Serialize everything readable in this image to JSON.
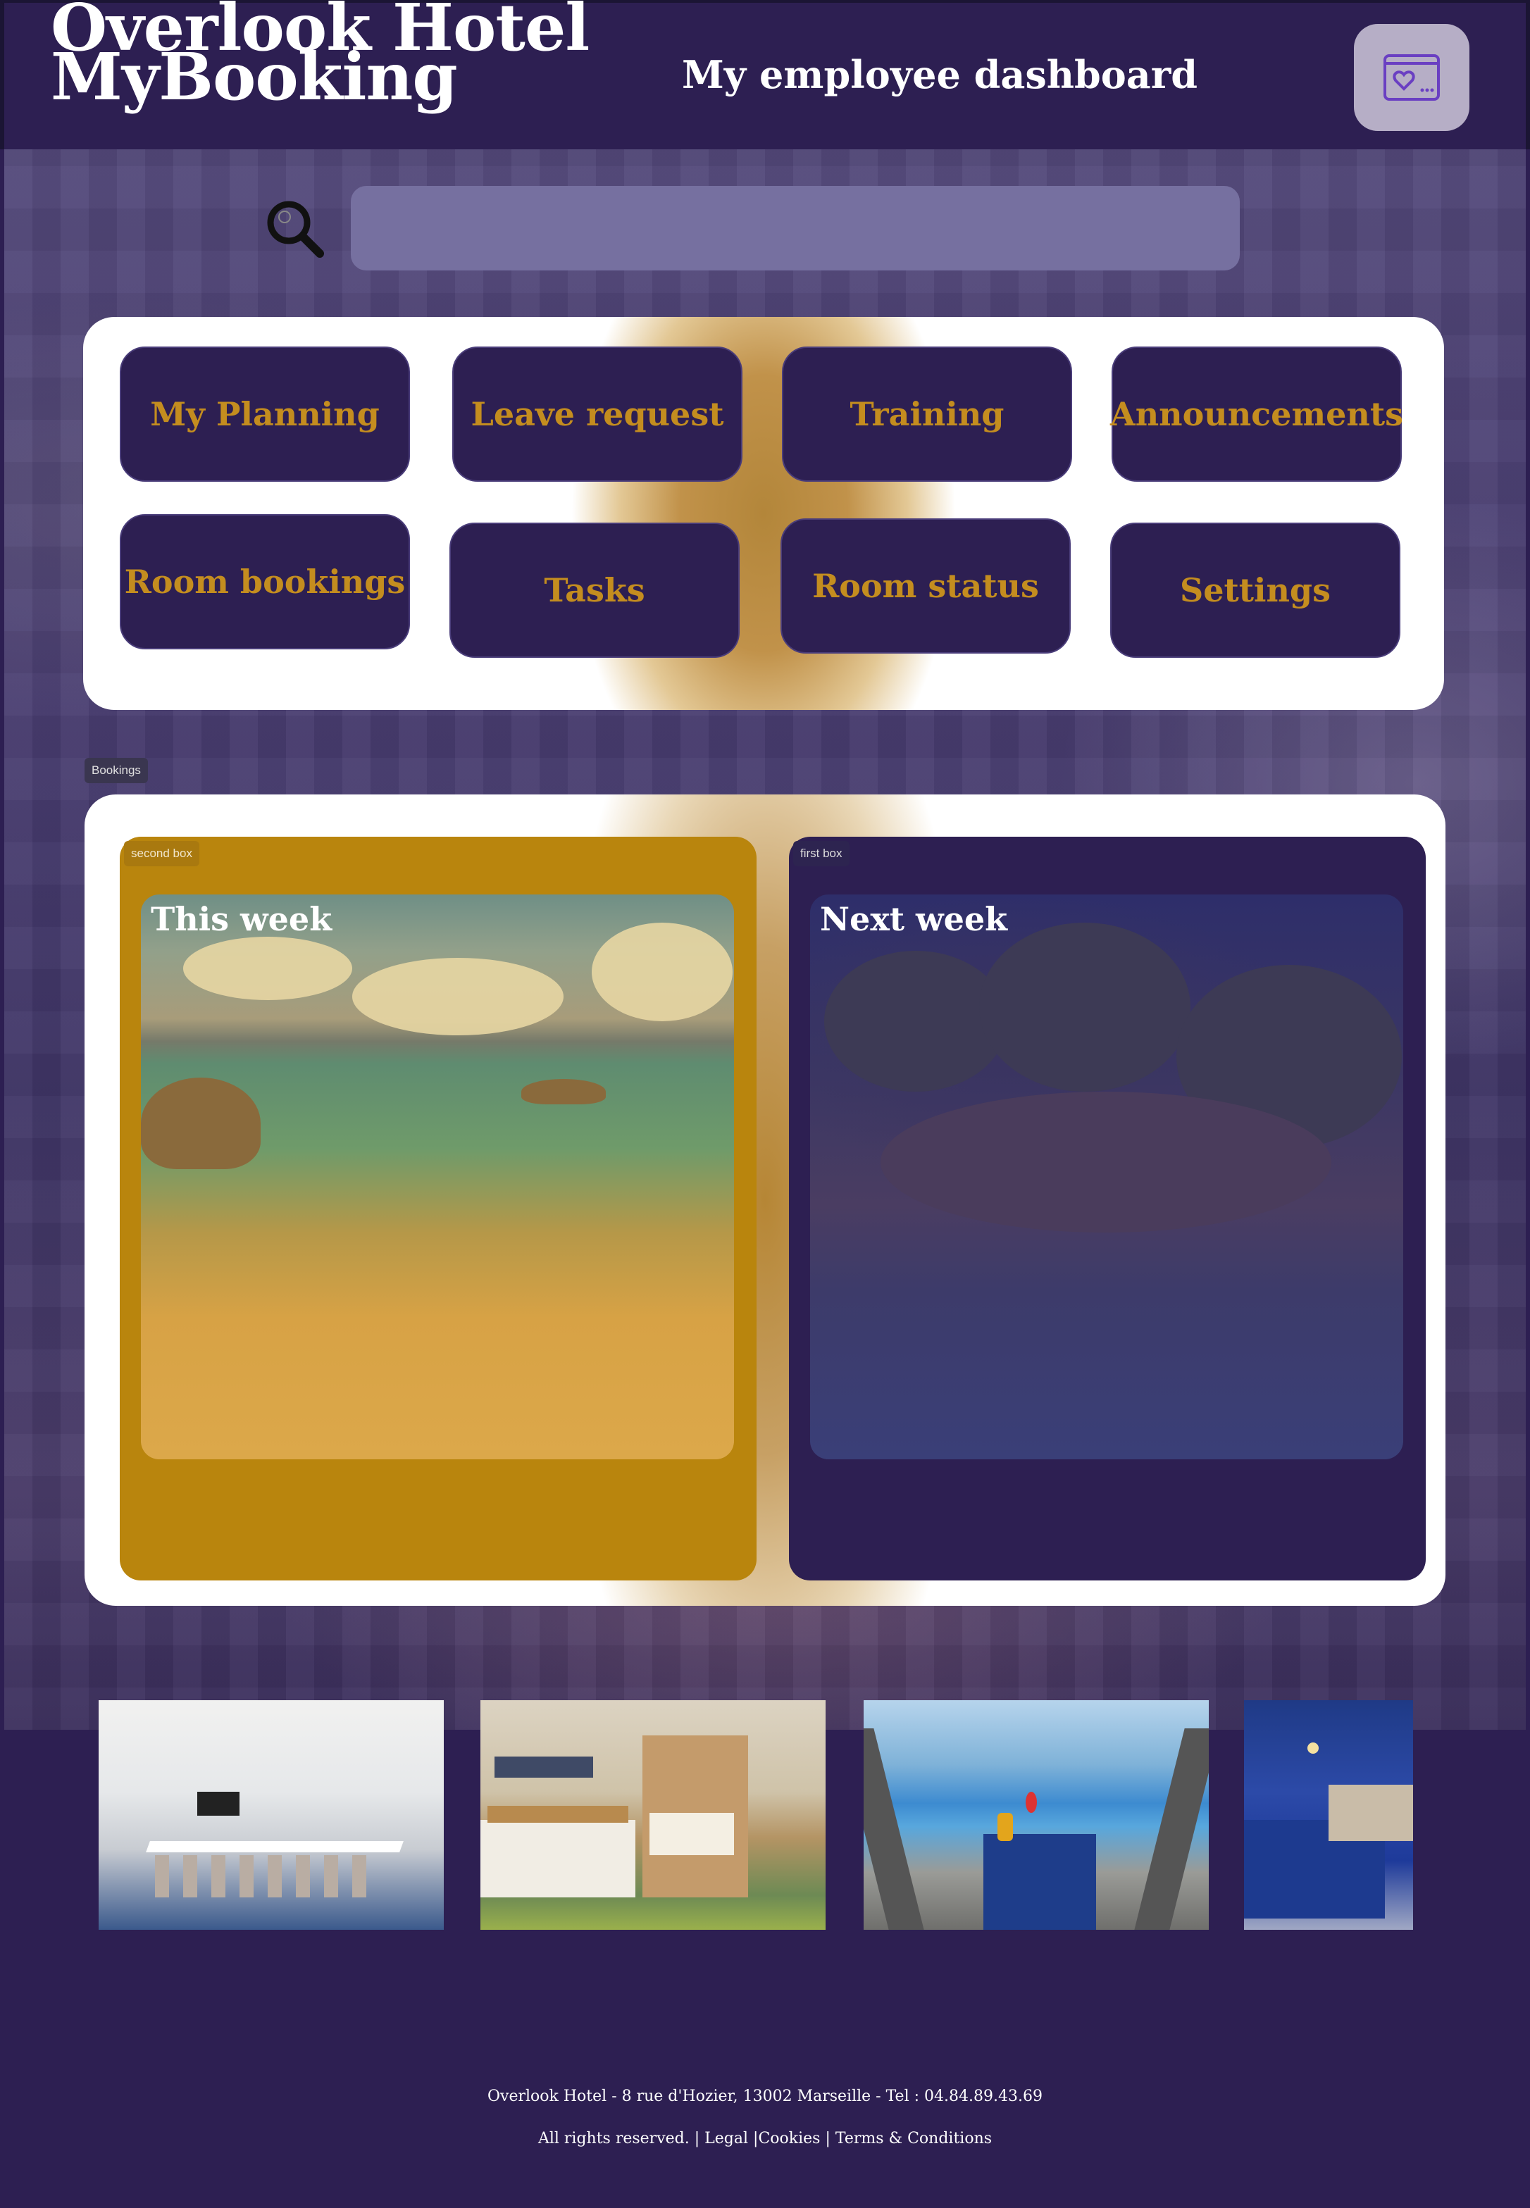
{
  "header": {
    "brand_line1": "Overlook Hotel",
    "brand_line2": "MyBooking",
    "dashboard_title": "My employee dashboard",
    "account_icon": "profile-heart-icon"
  },
  "search": {
    "icon": "search-icon",
    "placeholder": ""
  },
  "menu": {
    "items": [
      {
        "label": "My Planning"
      },
      {
        "label": "Leave request"
      },
      {
        "label": "Training"
      },
      {
        "label": "Announcements"
      },
      {
        "label": "Room bookings"
      },
      {
        "label": "Tasks"
      },
      {
        "label": "Room status"
      },
      {
        "label": "Settings"
      }
    ]
  },
  "bookings": {
    "section_tag": "Bookings",
    "this_week": {
      "tag": "second box",
      "label": "This week"
    },
    "next_week": {
      "tag": "first box",
      "label": "Next week"
    }
  },
  "footer": {
    "address": "Overlook Hotel - 8 rue d'Hozier, 13002 Marseille - Tel : 04.84.89.43.69",
    "rights": "All rights reserved. |",
    "legal": "Legal",
    "sep1": "|",
    "cookies": "Cookies",
    "sep2": "|",
    "terms": "Terms & Conditions"
  },
  "colors": {
    "primary": "#2d1f52",
    "accent_gold": "#c48d1f",
    "box_gold": "#b9850d"
  }
}
